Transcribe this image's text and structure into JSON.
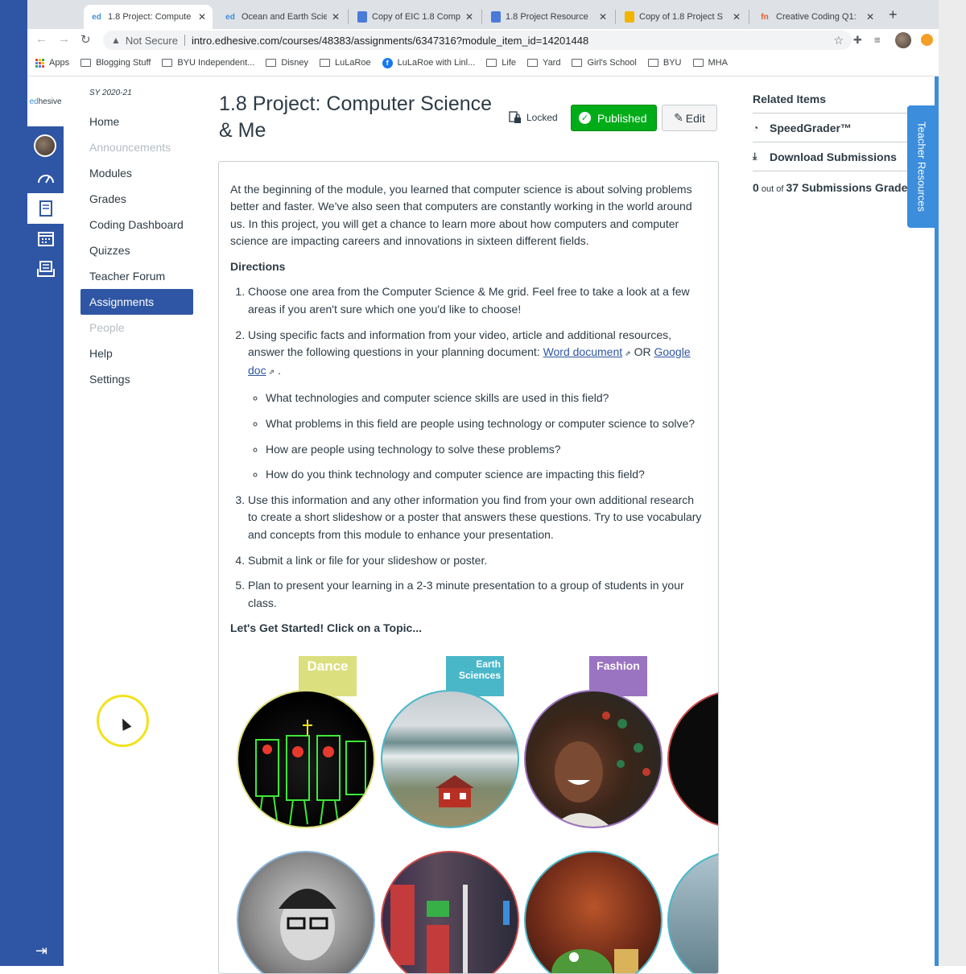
{
  "browser": {
    "tabs": [
      {
        "title": "1.8 Project: Compute",
        "icon": "ed"
      },
      {
        "title": "Ocean and Earth Scie",
        "icon": "ed"
      },
      {
        "title": "Copy of EIC 1.8 Comp",
        "icon": "doc"
      },
      {
        "title": "1.8 Project Resource",
        "icon": "doc"
      },
      {
        "title": "Copy of 1.8 Project S",
        "icon": "slide"
      },
      {
        "title": "Creative Coding Q1:",
        "icon": "tm"
      }
    ],
    "tab_close": "✕",
    "new_tab": "+",
    "security_label": "Not Secure",
    "url": "intro.edhesive.com/courses/48383/assignments/6347316?module_item_id=14201448",
    "bookmarks": [
      "Apps",
      "Blogging Stuff",
      "BYU Independent...",
      "Disney",
      "LuLaRoe",
      "LuLaRoe with Linl...",
      "Life",
      "Yard",
      "Girl's School",
      "BYU",
      "MHA"
    ]
  },
  "global_nav": {
    "logo_prefix": "ed",
    "logo_suffix": "hesive"
  },
  "course_nav": {
    "term": "SY 2020-21",
    "items": [
      {
        "label": "Home",
        "state": "normal"
      },
      {
        "label": "Announcements",
        "state": "muted"
      },
      {
        "label": "Modules",
        "state": "normal"
      },
      {
        "label": "Grades",
        "state": "normal"
      },
      {
        "label": "Coding Dashboard",
        "state": "normal"
      },
      {
        "label": "Quizzes",
        "state": "normal"
      },
      {
        "label": "Teacher Forum",
        "state": "normal"
      },
      {
        "label": "Assignments",
        "state": "active"
      },
      {
        "label": "People",
        "state": "muted"
      },
      {
        "label": "Help",
        "state": "normal"
      },
      {
        "label": "Settings",
        "state": "normal"
      }
    ]
  },
  "assignment": {
    "title": "1.8 Project: Computer Science & Me",
    "locked_label": "Locked",
    "published_label": "Published",
    "edit_label": "Edit",
    "intro": "At the beginning of the module, you learned that computer science is about solving problems better and faster. We've also seen that computers are constantly working in the world around us. In this project, you will get a chance to learn more about how computers and computer science are impacting careers and innovations in sixteen different fields.",
    "directions_heading": "Directions",
    "step1": "Choose one area from the Computer Science & Me grid. Feel free to take a look at a few areas if you aren't sure which one you'd like to choose!",
    "step2_text": "Using specific facts and information from your video, article and additional resources, answer the following questions in your planning document: ",
    "step2_link1": "Word document",
    "step2_or": " OR ",
    "step2_link2": "Google doc",
    "step2_end": " .",
    "questions": [
      "What technologies and computer science skills are used in this field?",
      "What problems in this field are people using technology or computer science to solve?",
      "How are people using technology to solve these problems?",
      "How do you think technology and computer science are impacting this field?"
    ],
    "step3": "Use this information and any other information you find from your own additional research to create a short slideshow or a poster that answers these questions. Try to use vocabulary and concepts from this module to enhance your presentation.",
    "step4": "Submit a link or file for your slideshow or poster.",
    "step5": "Plan to present your learning in a 2-3 minute presentation to a group of students in your class.",
    "get_started": "Let's Get Started!  Click on a Topic...",
    "topics": [
      {
        "label": "Dance",
        "color": "#dcdf7e"
      },
      {
        "label": "Earth Sciences",
        "color": "#4ab7c9"
      },
      {
        "label": "Fashion",
        "color": "#9a74c0"
      }
    ]
  },
  "related": {
    "heading": "Related Items",
    "speedgrader": "SpeedGrader™",
    "download": "Download Submissions",
    "graded_count": "0",
    "graded_mid": " out of ",
    "graded_total": "37",
    "graded_suffix": " Submissions Graded"
  },
  "teacher_resources": "Teacher Resources"
}
